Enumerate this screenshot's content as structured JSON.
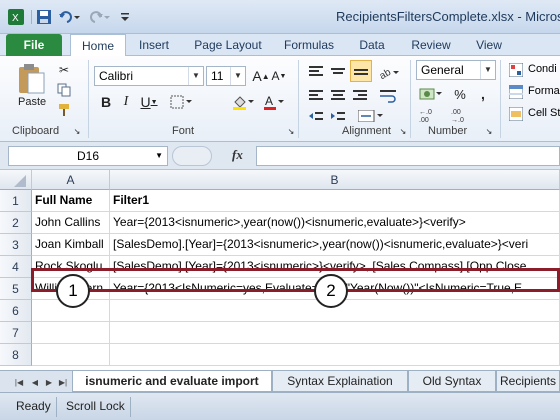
{
  "window": {
    "title": "RecipientsFiltersComplete.xlsx - Microsoft"
  },
  "ribbon_tabs": [
    "File",
    "Home",
    "Insert",
    "Page Layout",
    "Formulas",
    "Data",
    "Review",
    "View"
  ],
  "ribbon": {
    "clipboard": {
      "label": "Clipboard",
      "paste": "Paste"
    },
    "font": {
      "label": "Font",
      "family": "Calibri",
      "size": "11"
    },
    "alignment": {
      "label": "Alignment"
    },
    "number": {
      "label": "Number",
      "format": "General"
    },
    "styles": {
      "conditional": "Condi",
      "format_as": "Forma",
      "cell_styles": "Cell St"
    }
  },
  "formula_bar": {
    "name_box": "D16",
    "fx": "fx",
    "content": ""
  },
  "grid": {
    "columns": [
      "A",
      "B"
    ],
    "rows": [
      {
        "num": "1",
        "a": "Full Name",
        "b": "Filter1"
      },
      {
        "num": "2",
        "a": "John Callins",
        "b": "Year={2013<isnumeric>,year(now())<isnumeric,evaluate>}<verify>"
      },
      {
        "num": "3",
        "a": "Joan Kimball",
        "b": "[SalesDemo].[Year]={2013<isnumeric>,year(now())<isnumeric,evaluate>}<veri"
      },
      {
        "num": "4",
        "a": "Rock Skoglu",
        "b": "[SalesDemo].[Year]={2013<isnumeric>}<verify>, [Sales Compass].[Opp Close"
      },
      {
        "num": "5",
        "a": "William Hern",
        "b": "Year={2013<IsNumeric=yes,Evaluate=no>, \"Year(Now())\"<IsNumeric=True,E"
      },
      {
        "num": "6",
        "a": "",
        "b": ""
      },
      {
        "num": "7",
        "a": "",
        "b": ""
      },
      {
        "num": "8",
        "a": "",
        "b": ""
      }
    ]
  },
  "callouts": [
    "1",
    "2"
  ],
  "sheet_tabs": [
    "isnumeric and evaluate import",
    "Syntax Explaination",
    "Old Syntax",
    "Recipients"
  ],
  "status": {
    "ready": "Ready",
    "scroll_lock": "Scroll Lock"
  }
}
